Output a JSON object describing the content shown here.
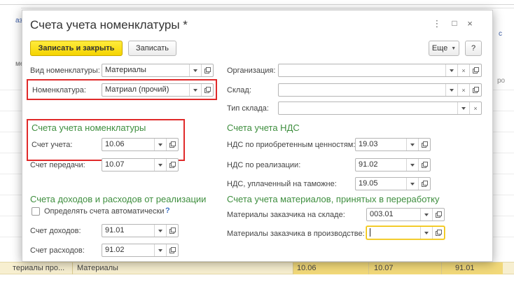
{
  "background": {
    "left_texts": [
      "аз",
      "ме"
    ],
    "right_texts": [
      "ро",
      "с"
    ],
    "bottom_row": {
      "col1": "териалы про...",
      "col2": "Материалы",
      "col3": "10.06",
      "col4": "10.07",
      "col5": "91.01"
    }
  },
  "window": {
    "title": "Счета учета номенклатуры *",
    "more_icon": "⋮",
    "maximize_icon": "□",
    "close_icon": "×"
  },
  "toolbar": {
    "save_close_label": "Записать и закрыть",
    "save_label": "Записать",
    "more_label": "Еще",
    "help_label": "?"
  },
  "left": {
    "kind_label": "Вид номенклатуры:",
    "kind_value": "Материалы",
    "item_label": "Номенклатура:",
    "item_value": "Матриал (прочий)"
  },
  "right": {
    "org_label": "Организация:",
    "org_value": "",
    "warehouse_label": "Склад:",
    "warehouse_value": "",
    "wh_type_label": "Тип склада:",
    "wh_type_value": ""
  },
  "accounts": {
    "title": "Счета учета номенклатуры",
    "account_label": "Счет учета:",
    "account_value": "10.06",
    "transfer_label": "Счет передачи:",
    "transfer_value": "10.07"
  },
  "vat": {
    "title": "Счета учета НДС",
    "acquired_label": "НДС по приобретенным ценностям:",
    "acquired_value": "19.03",
    "sales_label": "НДС по реализации:",
    "sales_value": "91.02",
    "customs_label": "НДС, уплаченный на таможне:",
    "customs_value": "19.05"
  },
  "income": {
    "title": "Счета доходов и расходов от реализации",
    "auto_label": "Определять счета автоматически",
    "auto_checked": false,
    "help": "?",
    "income_label": "Счет доходов:",
    "income_value": "91.01",
    "expense_label": "Счет расходов:",
    "expense_value": "91.02"
  },
  "processing": {
    "title": "Счета учета материалов, принятых в переработку",
    "warehouse_label": "Материалы заказчика на складе:",
    "warehouse_value": "003.01",
    "production_label": "Материалы заказчика в производстве:",
    "production_value": ""
  },
  "colors": {
    "accent_yellow": "#f5d400",
    "section_green": "#3e8e3e",
    "highlight_red": "#e02a2a",
    "row_highlight": "#f7efd0"
  }
}
